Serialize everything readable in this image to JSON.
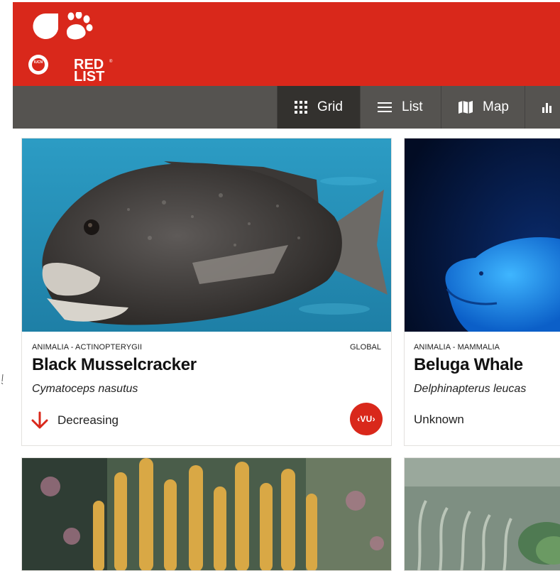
{
  "brand": {
    "logo_line1": "RED",
    "logo_line2": "LIST",
    "logo_tm": "®",
    "badge_text": "IUCN",
    "color": "#d9281b"
  },
  "nav": {
    "items": [
      {
        "label": "Grid",
        "icon": "grid-icon",
        "active": true
      },
      {
        "label": "List",
        "icon": "list-icon",
        "active": false
      },
      {
        "label": "Map",
        "icon": "map-icon",
        "active": false
      },
      {
        "label": "",
        "icon": "bar-chart-icon",
        "active": false
      }
    ]
  },
  "cards": [
    {
      "taxonomy": "ANIMALIA - ACTINOPTERYGII",
      "scope": "GLOBAL",
      "common_name": "Black Musselcracker",
      "scientific_name": "Cymatoceps nasutus",
      "trend": "Decreasing",
      "trend_icon": "arrow-down-icon",
      "category": "VU",
      "image": "fish-photo"
    },
    {
      "taxonomy": "ANIMALIA - MAMMALIA",
      "scope": "",
      "common_name": "Beluga Whale",
      "scientific_name": "Delphinapterus leucas",
      "trend": "Unknown",
      "image": "whale-photo"
    },
    {
      "image": "coral-photo"
    },
    {
      "image": "seagrass-photo"
    }
  ]
}
